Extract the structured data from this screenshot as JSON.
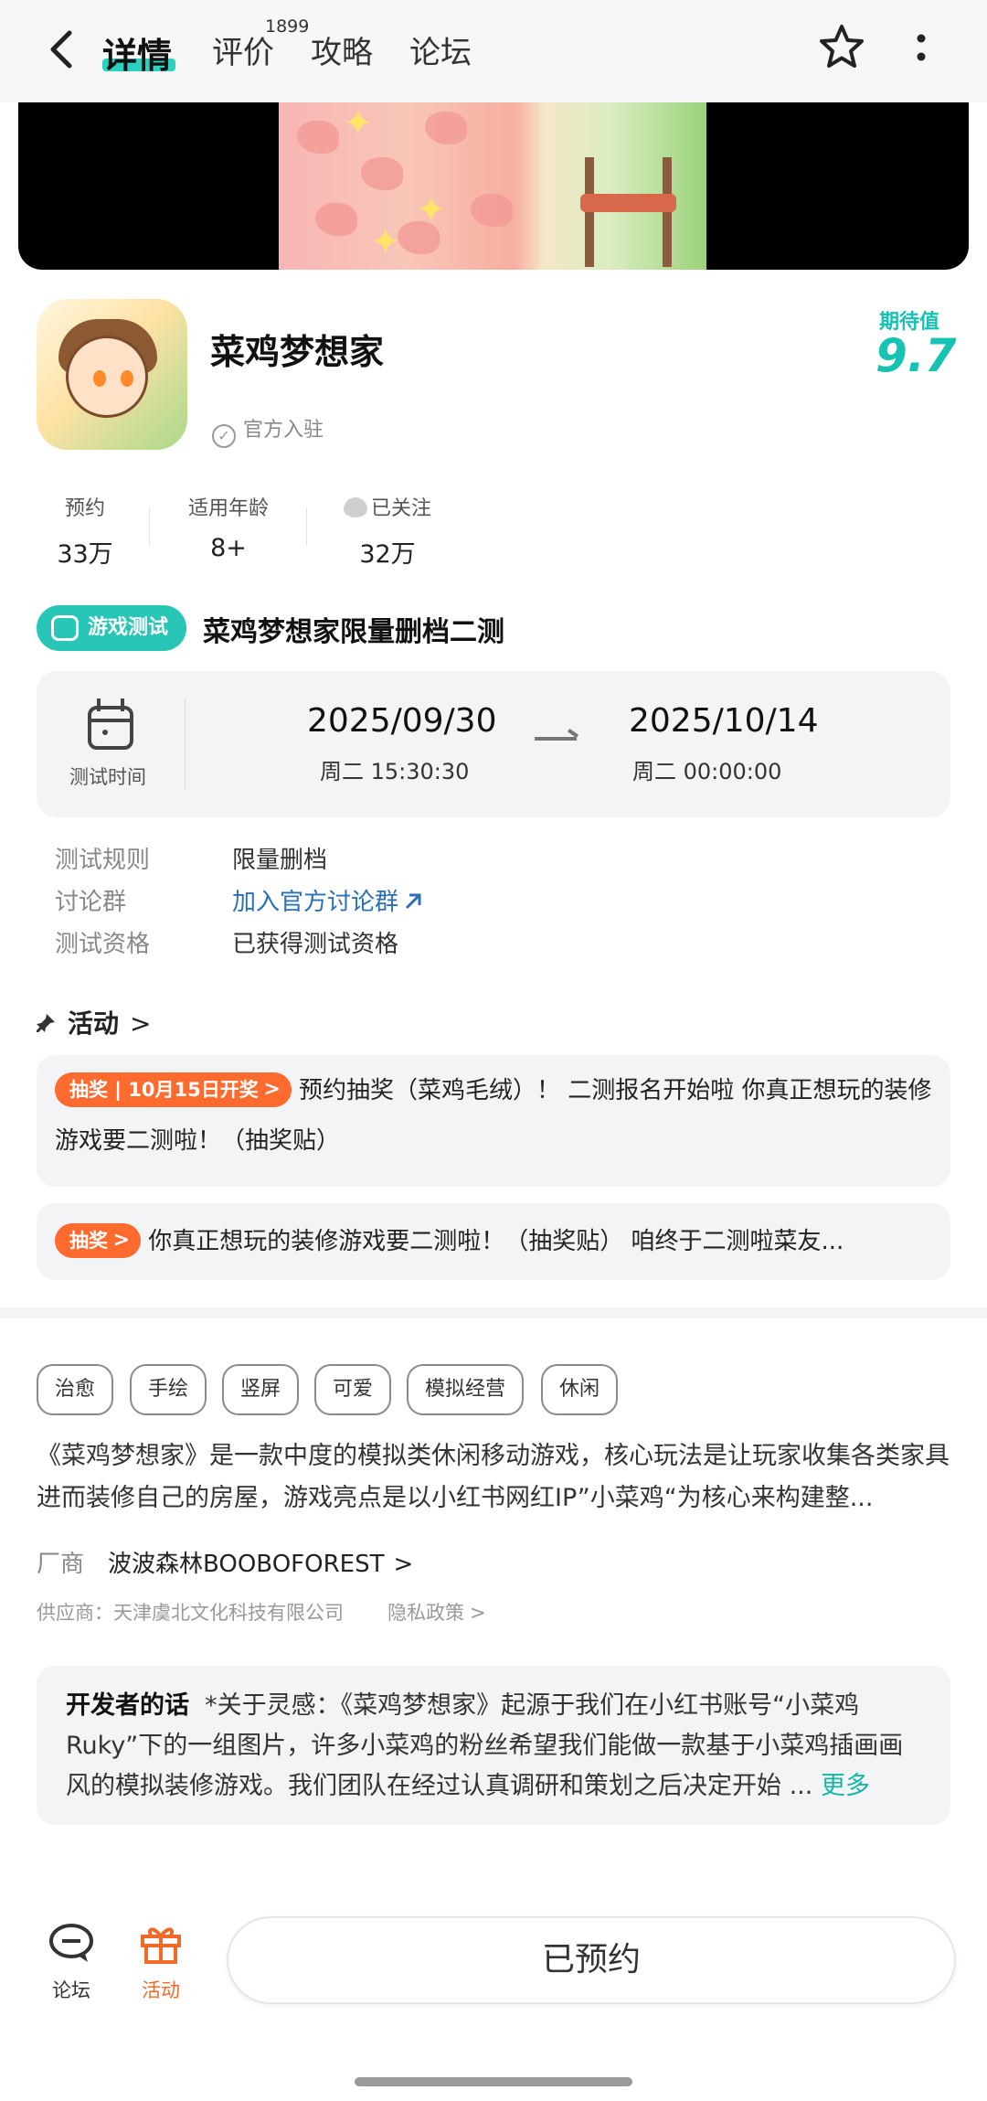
{
  "nav": {
    "tabs": [
      {
        "label": "详情"
      },
      {
        "label": "评价"
      },
      {
        "label": "攻略"
      },
      {
        "label": "论坛"
      }
    ],
    "review_count": "1899",
    "icons": {
      "back": "back-arrow-icon",
      "star": "star-icon",
      "more": "more-vertical-icon"
    }
  },
  "app": {
    "name": "菜鸡梦想家",
    "official_label": "官方入驻",
    "expectation_label": "期待值",
    "expectation_score": "9.7"
  },
  "stats": [
    {
      "label": "预约",
      "value": "33万"
    },
    {
      "label": "适用年龄",
      "value": "8+"
    },
    {
      "label": "已关注",
      "value": "32万"
    }
  ],
  "test": {
    "badge": "游戏测试",
    "title": "菜鸡梦想家限量删档二测",
    "time_label": "测试时间",
    "start_date": "2025/09/30",
    "start_time": "周二  15:30:30",
    "end_date": "2025/10/14",
    "end_time": "周二  00:00:00",
    "rows": [
      {
        "label": "测试规则",
        "value": "限量删档"
      },
      {
        "label": "讨论群",
        "value": "加入官方讨论群"
      },
      {
        "label": "测试资格",
        "value": "已获得测试资格"
      }
    ]
  },
  "activity": {
    "header": "活动",
    "items": [
      {
        "tag": "抽奖 | 10月15日开奖",
        "text": "预约抽奖（菜鸡毛绒）！ 二测报名开始啦 你真正想玩的装修游戏要二测啦！（抽奖贴）"
      },
      {
        "tag": "抽奖",
        "text": "你真正想玩的装修游戏要二测啦！（抽奖贴） 咱终于二测啦菜友..."
      }
    ]
  },
  "tags": [
    "治愈",
    "手绘",
    "竖屏",
    "可爱",
    "模拟经营",
    "休闲"
  ],
  "description": "《菜鸡梦想家》是一款中度的模拟类休闲移动游戏，核心玩法是让玩家收集各类家具进而装修自己的房屋，游戏亮点是以小红书网红IP”小菜鸡“为核心来构建整...",
  "vendor": {
    "label": "厂商",
    "value": "波波森林BOOBOFOREST"
  },
  "supplier": "供应商：天津虞北文化科技有限公司",
  "privacy": "隐私政策",
  "developer": {
    "title": "开发者的话",
    "text": "*关于灵感：《菜鸡梦想家》起源于我们在小红书账号“小菜鸡Ruky”下的一组图片，许多小菜鸡的粉丝希望我们能做一款基于小菜鸡插画画风的模拟装修游戏。我们团队在经过认真调研和策划之后决定开始 ...",
    "more": "更多"
  },
  "bottom": {
    "forum": "论坛",
    "activity": "活动",
    "reserve": "已预约"
  },
  "colors": {
    "accent": "#16c2b3",
    "orange": "#ff6a2f",
    "link": "#2b6fb8"
  }
}
